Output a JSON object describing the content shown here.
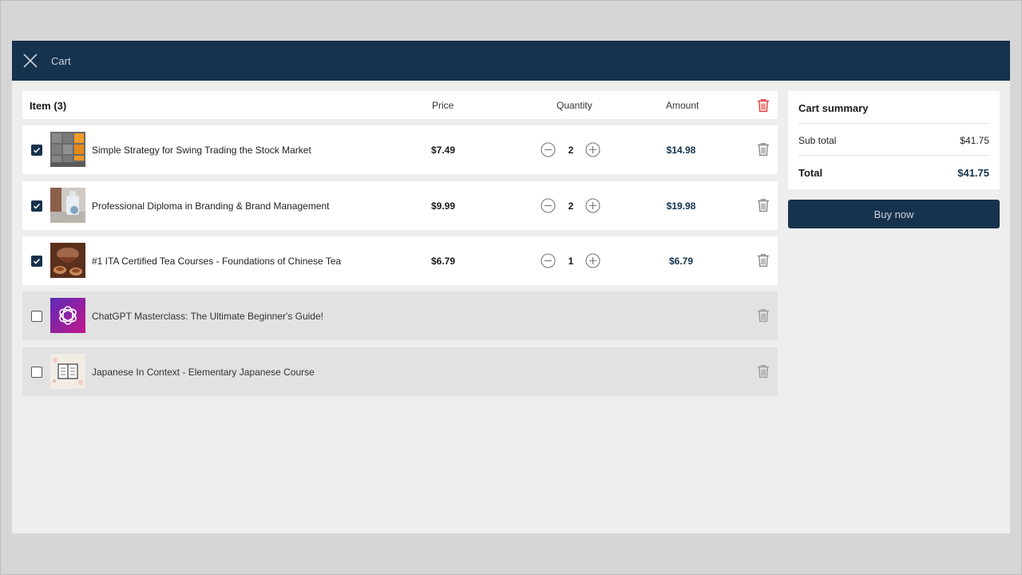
{
  "header": {
    "title": "Cart"
  },
  "table": {
    "item_header": "Item (3)",
    "price_header": "Price",
    "quantity_header": "Quantity",
    "amount_header": "Amount"
  },
  "items": [
    {
      "title": "Simple Strategy for Swing Trading the Stock Market",
      "price": "$7.49",
      "quantity": "2",
      "amount": "$14.98",
      "checked": true,
      "thumb": "stock-thumb"
    },
    {
      "title": "Professional Diploma in Branding & Brand Management",
      "price": "$9.99",
      "quantity": "2",
      "amount": "$19.98",
      "checked": true,
      "thumb": "branding-thumb"
    },
    {
      "title": "#1 ITA Certified Tea Courses - Foundations of Chinese Tea",
      "price": "$6.79",
      "quantity": "1",
      "amount": "$6.79",
      "checked": true,
      "thumb": "tea-thumb"
    },
    {
      "title": "ChatGPT Masterclass: The Ultimate Beginner's Guide!",
      "checked": false,
      "thumb": "chatgpt-thumb"
    },
    {
      "title": "Japanese In Context - Elementary Japanese Course",
      "checked": false,
      "thumb": "japanese-thumb"
    }
  ],
  "summary": {
    "title": "Cart summary",
    "subtotal_label": "Sub total",
    "subtotal_value": "$41.75",
    "total_label": "Total",
    "total_value": "$41.75"
  },
  "buy_label": "Buy now",
  "colors": {
    "navy": "#17324d",
    "danger": "#e03a3a",
    "background": "#eeeeee"
  }
}
